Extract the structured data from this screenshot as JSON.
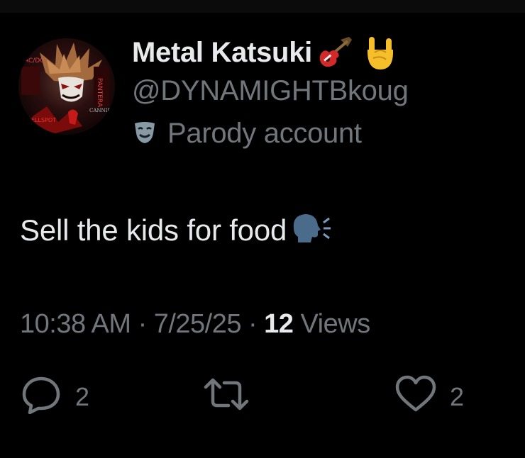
{
  "tweet": {
    "author": {
      "display_name": "Metal Katsuki",
      "name_emojis": [
        "guitar-emoji",
        "sign-of-horns-emoji"
      ],
      "handle": "@DYNAMIGHTBkoug",
      "parody_label": "Parody account"
    },
    "text": "Sell the kids for food",
    "text_emoji": "speaking-head-emoji",
    "meta": {
      "time": "10:38 AM",
      "separator": "·",
      "date": "7/25/25",
      "views_count": "12",
      "views_label": "Views"
    },
    "actions": {
      "reply_count": "2",
      "like_count": "2"
    }
  },
  "colors": {
    "background": "#000000",
    "primary_text": "#e7e9ea",
    "secondary_text": "#71767b"
  },
  "icons": [
    "avatar",
    "guitar-emoji",
    "sign-of-horns-emoji",
    "parody-mask-icon",
    "speaking-head-emoji",
    "reply-icon",
    "retweet-icon",
    "like-icon"
  ]
}
